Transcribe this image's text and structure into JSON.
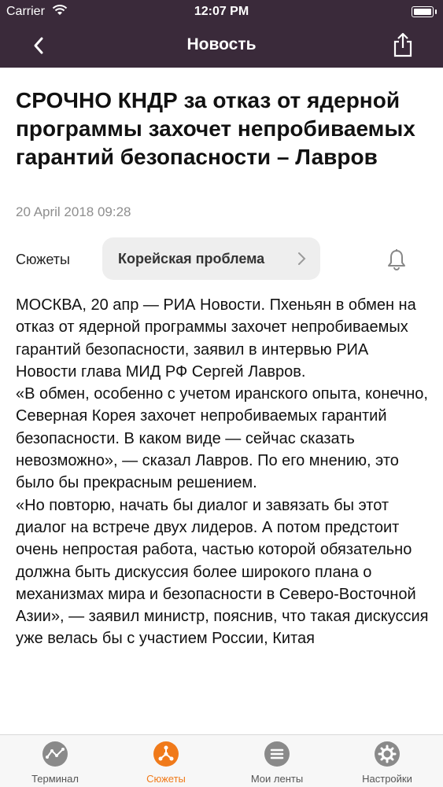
{
  "status_bar": {
    "carrier": "Carrier",
    "time": "12:07 PM"
  },
  "nav": {
    "title": "Новость",
    "back_icon": "chevron-left-icon",
    "share_icon": "share-icon"
  },
  "article": {
    "headline": "СРОЧНО КНДР за отказ от ядерной программы захочет непробиваемых гарантий безопасности – Лавров",
    "date": "20 April 2018 09:28",
    "story_label": "Сюжеты",
    "story_chip": "Корейская проблема",
    "paragraphs": [
      "МОСКВА, 20 апр — РИА Новости. Пхеньян в обмен на отказ от ядерной программы захочет непробиваемых гарантий безопасности, заявил в интервью РИА Новости глава МИД РФ Сергей Лавров.",
      "«В обмен, особенно с учетом иранского опыта, конечно, Северная Корея захочет непробиваемых гарантий безопасности. В каком виде — сейчас сказать невозможно», — сказал Лавров. По его мнению, это было бы прекрасным решением.",
      "«Но повторю, начать бы диалог и завязать бы этот диалог на встрече двух лидеров. А потом предстоит очень непростая работа, частью которой обязательно должна быть дискуссия более широкого плана о механизмах мира и безопасности в Северо-Восточной Азии», — заявил министр, пояснив, что такая дискуссия уже велась бы с участием России, Китая"
    ]
  },
  "tabs": [
    {
      "label": "Терминал",
      "icon": "terminal-icon",
      "active": false
    },
    {
      "label": "Сюжеты",
      "icon": "stories-icon",
      "active": true
    },
    {
      "label": "Мои ленты",
      "icon": "feeds-icon",
      "active": false
    },
    {
      "label": "Настройки",
      "icon": "gear-icon",
      "active": false
    }
  ],
  "colors": {
    "nav_bg": "#3a2a3a",
    "accent": "#f07a1a",
    "inactive_icon": "#8a8a8a"
  }
}
